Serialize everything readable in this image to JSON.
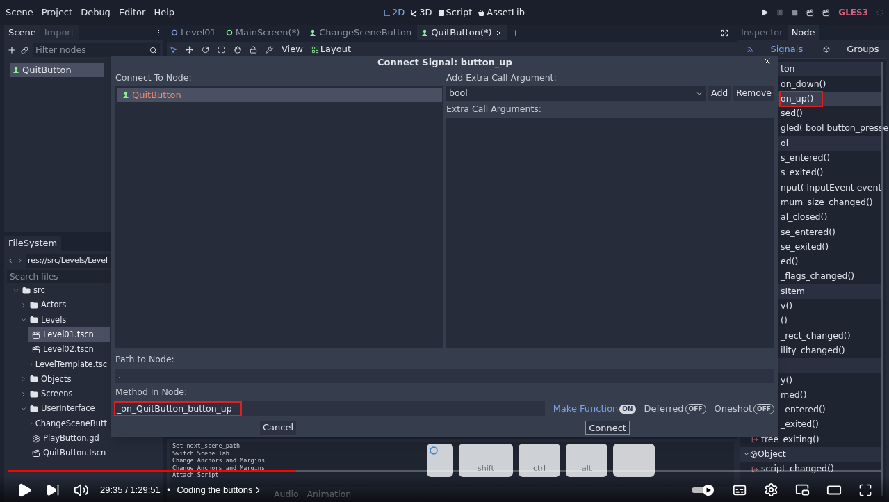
{
  "menu": [
    "Scene",
    "Project",
    "Debug",
    "Editor",
    "Help"
  ],
  "workspaces": [
    {
      "label": "2D",
      "kind": "flat",
      "selected": true
    },
    {
      "label": "3D",
      "kind": "spatial",
      "selected": false
    },
    {
      "label": "Script",
      "kind": "script",
      "selected": false
    },
    {
      "label": "AssetLib",
      "kind": "assetlib",
      "selected": false
    }
  ],
  "renderer": "GLES3",
  "scene_dock": {
    "tabs": [
      {
        "label": "Scene",
        "selected": true
      },
      {
        "label": "Import",
        "selected": false
      }
    ],
    "filter_placeholder": "Filter nodes",
    "tree": [
      {
        "label": "QuitButton",
        "selected": true
      }
    ]
  },
  "filesystem": {
    "tab": "FileSystem",
    "path": "res://src/Levels/Level",
    "search_placeholder": "Search files",
    "tree": [
      {
        "label": "src",
        "kind": "folder",
        "expanded": true,
        "selected": false,
        "children": [
          {
            "label": "Actors",
            "kind": "folder",
            "expanded": false,
            "selected": false
          },
          {
            "label": "Levels",
            "kind": "folder",
            "expanded": true,
            "selected": false,
            "children": [
              {
                "label": "Level01.tscn",
                "kind": "scene",
                "selected": true
              },
              {
                "label": "Level02.tscn",
                "kind": "scene",
                "selected": false
              },
              {
                "label": "LevelTemplate.tsc",
                "kind": "scene",
                "selected": false
              }
            ]
          },
          {
            "label": "Objects",
            "kind": "folder",
            "expanded": false,
            "selected": false
          },
          {
            "label": "Screens",
            "kind": "folder",
            "expanded": false,
            "selected": false
          },
          {
            "label": "UserInterface",
            "kind": "folder",
            "expanded": true,
            "selected": false,
            "children": [
              {
                "label": "ChangeSceneButt",
                "kind": "scene",
                "selected": false
              },
              {
                "label": "PlayButton.gd",
                "kind": "script",
                "selected": false
              },
              {
                "label": "QuitButton.tscn",
                "kind": "scene",
                "selected": false
              }
            ]
          }
        ]
      }
    ]
  },
  "scene_tabs": [
    {
      "label": "Level01",
      "kind": "circle",
      "color": "#8da5f3",
      "selected": false
    },
    {
      "label": "MainScreen(*)",
      "kind": "circle",
      "color": "#8eef97",
      "selected": false
    },
    {
      "label": "ChangeSceneButton",
      "kind": "control",
      "color": "#8eef97",
      "selected": false
    },
    {
      "label": "QuitButton(*)",
      "kind": "control",
      "color": "#8eef97",
      "selected": true
    }
  ],
  "toolbar": {
    "view": "View",
    "layout": "Layout"
  },
  "output": {
    "lines": [
      "Set next_scene_path",
      "Switch Scene Tab",
      "Change Anchors and Margins",
      "Change Anchors and Margins",
      "Attach Script"
    ],
    "tabs": [
      {
        "label": "Audio",
        "selected": false
      },
      {
        "label": "Animation",
        "selected": false
      }
    ]
  },
  "right_dock": {
    "tabs": [
      {
        "label": "Inspector",
        "selected": false
      },
      {
        "label": "Node",
        "selected": true
      }
    ],
    "subtabs": [
      {
        "label": "Signals",
        "kind": "signals",
        "selected": true
      },
      {
        "label": "Groups",
        "kind": "groups",
        "selected": false
      }
    ],
    "signals": [
      {
        "label": "ton",
        "kind": "header",
        "highlighted": false
      },
      {
        "label": "on_down()",
        "kind": "signal",
        "highlighted": false
      },
      {
        "label": "on_up()",
        "kind": "signal",
        "highlighted": true
      },
      {
        "label": "sed()",
        "kind": "signal",
        "highlighted": false
      },
      {
        "label": "gled( bool button_presse",
        "kind": "signal",
        "highlighted": false
      },
      {
        "label": "ol",
        "kind": "header",
        "highlighted": false
      },
      {
        "label": "s_entered()",
        "kind": "signal",
        "highlighted": false
      },
      {
        "label": "s_exited()",
        "kind": "signal",
        "highlighted": false
      },
      {
        "label": "nput( InputEvent event",
        "kind": "signal",
        "highlighted": false
      },
      {
        "label": "mum_size_changed()",
        "kind": "signal",
        "highlighted": false
      },
      {
        "label": "al_closed()",
        "kind": "signal",
        "highlighted": false
      },
      {
        "label": "se_entered()",
        "kind": "signal",
        "highlighted": false
      },
      {
        "label": "se_exited()",
        "kind": "signal",
        "highlighted": false
      },
      {
        "label": "ed()",
        "kind": "signal",
        "highlighted": false
      },
      {
        "label": "_flags_changed()",
        "kind": "signal",
        "highlighted": false
      },
      {
        "label": "sItem",
        "kind": "header",
        "highlighted": false
      },
      {
        "label": "v()",
        "kind": "signal",
        "highlighted": false
      },
      {
        "label": "()",
        "kind": "signal",
        "highlighted": false
      },
      {
        "label": "_rect_changed()",
        "kind": "signal",
        "highlighted": false
      },
      {
        "label": "ility_changed()",
        "kind": "signal",
        "highlighted": false
      },
      {
        "kind": "header",
        "highlighted": false
      },
      {
        "label": "y()",
        "kind": "signal",
        "highlighted": false
      },
      {
        "label": "med()",
        "kind": "signal",
        "highlighted": false
      },
      {
        "label": "_entered()",
        "kind": "signal",
        "highlighted": false
      },
      {
        "label": "_exited()",
        "kind": "signal",
        "highlighted": false
      },
      {
        "label": "tree_exiting()",
        "kind": "signal_icon",
        "highlighted": false
      },
      {
        "label": "Object",
        "kind": "class",
        "highlighted": false
      },
      {
        "label": "script_changed()",
        "kind": "signal_icon",
        "highlighted": false
      }
    ]
  },
  "dialog": {
    "title": "Connect Signal: button_up",
    "connect_to_label": "Connect To Node:",
    "tree": [
      {
        "label": "QuitButton",
        "selected": true
      }
    ],
    "extra_arg_label": "Add Extra Call Argument:",
    "arg_type": "bool",
    "add": "Add",
    "remove": "Remove",
    "extra_args_label": "Extra Call Arguments:",
    "path_label": "Path to Node:",
    "path_value": ".",
    "method_label": "Method In Node:",
    "method_value": "_on_QuitButton_button_up",
    "method_highlighted": true,
    "toggles": [
      {
        "label": "Make Function",
        "state_text": "ON",
        "on": true
      },
      {
        "label": "Deferred",
        "state_text": "OFF",
        "on": false
      },
      {
        "label": "Oneshot",
        "state_text": "OFF",
        "on": false
      }
    ],
    "cancel": "Cancel",
    "connect": "Connect"
  },
  "keys": [
    {
      "kind": "mouse"
    },
    {
      "label": "shift",
      "kind": "key"
    },
    {
      "label": "ctrl",
      "kind": "key"
    },
    {
      "label": "alt",
      "kind": "key"
    },
    {
      "kind": "key"
    }
  ],
  "player": {
    "level": 0.33,
    "time": "29:35 / 1:29:51",
    "bullet": "•",
    "chapter": "Coding the buttons"
  }
}
